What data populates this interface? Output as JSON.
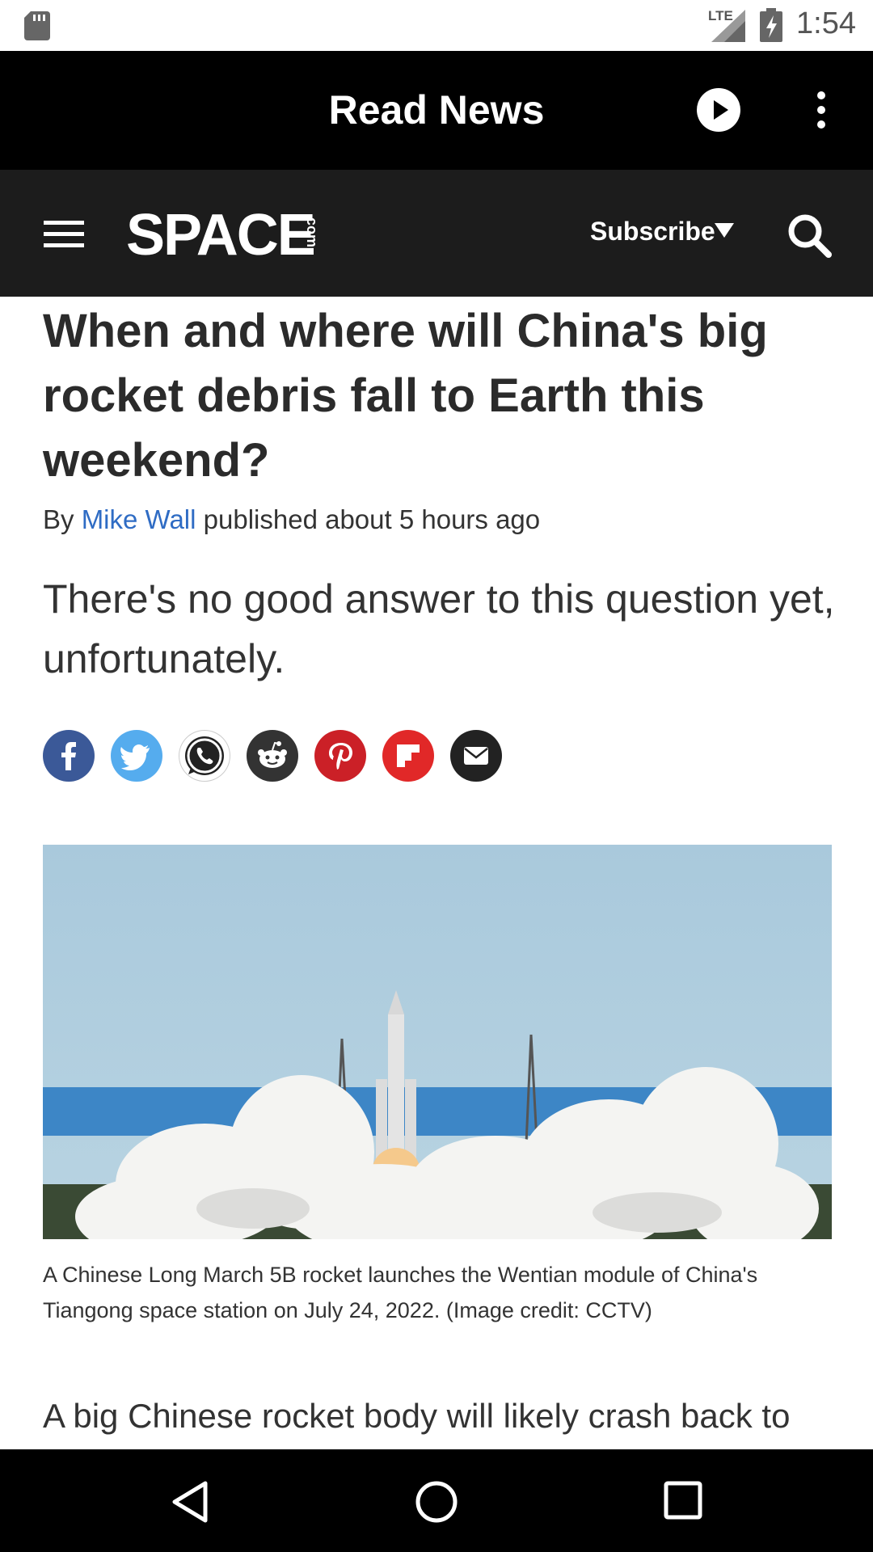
{
  "status_bar": {
    "time": "1:54",
    "network": "LTE",
    "icons": [
      "sd-card-icon",
      "signal-icon",
      "battery-charging-icon"
    ]
  },
  "app_bar": {
    "title": "Read News",
    "icons": [
      "play-icon",
      "more-vert-icon"
    ]
  },
  "site_header": {
    "logo_text": "SPACE",
    "logo_suffix": ".com",
    "subscribe_label": "Subscribe",
    "icons": [
      "menu-icon",
      "caret-down-icon",
      "search-icon"
    ]
  },
  "article": {
    "headline": "When and where will China's big rocket debris fall to Earth this weekend?",
    "byline_prefix": "By",
    "author": "Mike Wall",
    "published": "published about 5 hours ago",
    "standfirst": "There's no good answer to this question yet, unfortunately.",
    "share_buttons": [
      {
        "name": "facebook",
        "icon": "facebook-icon",
        "color": "#3b5998"
      },
      {
        "name": "twitter",
        "icon": "twitter-icon",
        "color": "#55acee"
      },
      {
        "name": "whatsapp",
        "icon": "whatsapp-icon",
        "color": "#ffffff"
      },
      {
        "name": "reddit",
        "icon": "reddit-icon",
        "color": "#333333"
      },
      {
        "name": "pinterest",
        "icon": "pinterest-icon",
        "color": "#cb2027"
      },
      {
        "name": "flipboard",
        "icon": "flipboard-icon",
        "color": "#e12828"
      },
      {
        "name": "email",
        "icon": "email-icon",
        "color": "#222222"
      }
    ],
    "image_caption": "A Chinese Long March 5B rocket launches the Wentian module of China's Tiangong space station on July 24, 2022. (Image credit: CCTV)",
    "body_first_line": "A big Chinese rocket body will likely crash back to"
  },
  "nav_bar": {
    "icons": [
      "back-icon",
      "home-icon",
      "recents-icon"
    ]
  }
}
